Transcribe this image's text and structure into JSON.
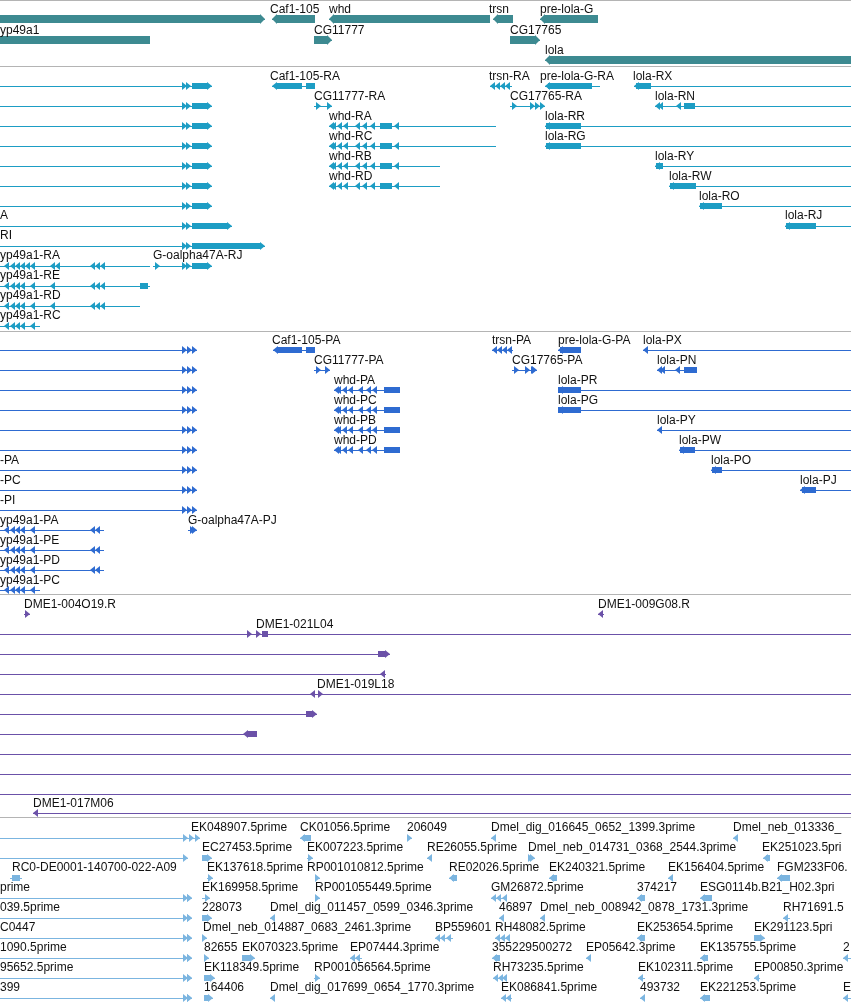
{
  "tracks": [
    {
      "kind": "gene",
      "color": "#3d8a91",
      "labels": [
        "Caf1-105",
        "whd",
        "trsn",
        "pre-lola-G",
        "yp49a1",
        "CG11777",
        "CG17765",
        "lola"
      ]
    },
    {
      "kind": "transcript",
      "color": "#1d9dc4",
      "labels": [
        "Caf1-105-RA",
        "trsn-RA",
        "pre-lola-G-RA",
        "lola-RX",
        "CG11777-RA",
        "CG17765-RA",
        "lola-RN",
        "whd-RA",
        "lola-RR",
        "whd-RC",
        "lola-RG",
        "whd-RB",
        "lola-RY",
        "whd-RD",
        "lola-RW",
        "lola-RO",
        "A",
        "lola-RJ",
        "RI",
        "yp49a1-RA",
        "G-oalpha47A-RJ",
        "yp49a1-RE",
        "yp49a1-RD",
        "yp49a1-RC"
      ]
    },
    {
      "kind": "protein",
      "color": "#2e6bd1",
      "labels": [
        "Caf1-105-PA",
        "trsn-PA",
        "pre-lola-G-PA",
        "lola-PX",
        "CG11777-PA",
        "CG17765-PA",
        "lola-PN",
        "whd-PA",
        "lola-PR",
        "whd-PC",
        "lola-PG",
        "whd-PB",
        "lola-PY",
        "whd-PD",
        "lola-PW",
        "-PA",
        "lola-PO",
        "-PC",
        "lola-PJ",
        "-PI",
        "yp49a1-PA",
        "G-oalpha47A-PJ",
        "yp49a1-PE",
        "yp49a1-PD",
        "yp49a1-PC"
      ]
    },
    {
      "kind": "clone",
      "color": "#6b51a8",
      "labels": [
        "DME1-004O19.R",
        "DME1-009G08.R",
        "DME1-021L04",
        "DME1-019L18",
        "DME1-017M06"
      ]
    },
    {
      "kind": "est",
      "color": "#7bb5e0",
      "labels": [
        "EK048907.5prime",
        "CK01056.5prime",
        "206049",
        "Dmel_dig_016645_0652_1399.3prime",
        "Dmel_neb_013336_",
        "EC27453.5prime",
        "EK007223.5prime",
        "RE26055.5prime",
        "Dmel_neb_014731_0368_2544.3prime",
        "EK251023.5pri",
        "RC0-DE0001-140700-022-A09",
        "EK137618.5prime",
        "RP001010812.5prime",
        "RE02026.5prime",
        "EK240321.5prime",
        "EK156404.5prime",
        "FGM233F06.",
        "prime",
        "EK169958.5prime",
        "RP001055449.5prime",
        "GM26872.5prime",
        "374217",
        "ESG0114b.B21_H02.3pri",
        "039.5prime",
        "228073",
        "Dmel_dig_011457_0599_0346.3prime",
        "46897",
        "Dmel_neb_008942_0878_1731.3prime",
        "RH71691.5",
        "C0447",
        "Dmel_neb_014887_0683_2461.3prime",
        "BP559601",
        "RH48082.5prime",
        "EK253654.5prime",
        "EK291123.5pri",
        "1090.5prime",
        "82655",
        "EK070323.5prime",
        "EP07444.3prime",
        "355229500272",
        "EP05642.3prime",
        "EK135755.5prime",
        "2",
        "95652.5prime",
        "EK118349.5prime",
        "RP001056564.5prime",
        "RH73235.5prime",
        "EK102311.5prime",
        "EP00850.3prime",
        "399",
        "164406",
        "Dmel_dig_017699_0654_1770.3prime",
        "EK086841.5prime",
        "493732",
        "EK221253.5prime",
        "E"
      ]
    }
  ]
}
